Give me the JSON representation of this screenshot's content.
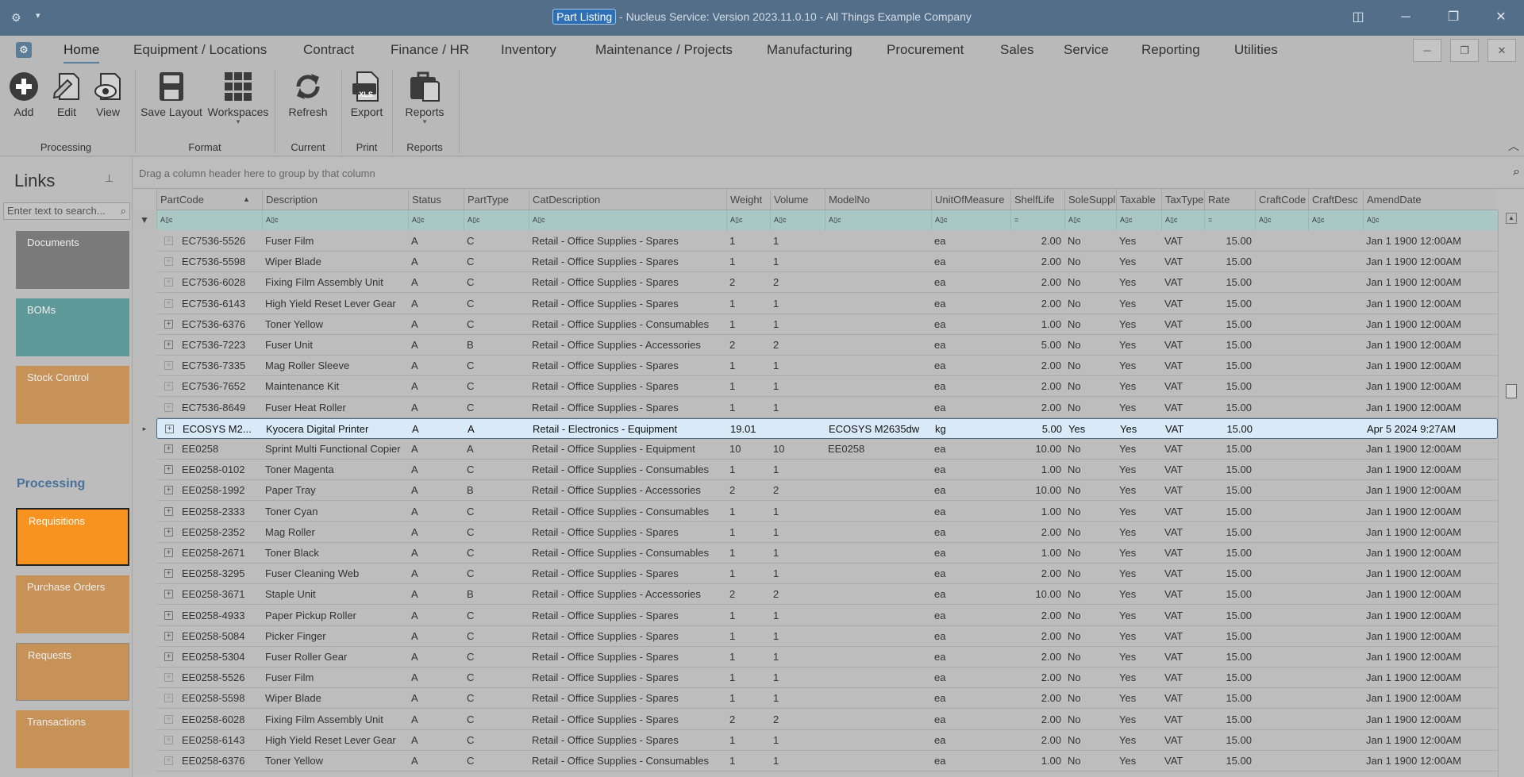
{
  "titlebar": {
    "highlight": "Part Listing",
    "rest": " - Nucleus Service: Version 2023.11.0.10 - All Things Example Company",
    "menu_caret": "▾"
  },
  "menu": {
    "items": [
      "Home",
      "Equipment / Locations",
      "Contract",
      "Finance / HR",
      "Inventory",
      "Maintenance / Projects",
      "Manufacturing",
      "Procurement",
      "Sales",
      "Service",
      "Reporting",
      "Utilities"
    ]
  },
  "ribbon": {
    "buttons": {
      "add": "Add",
      "edit": "Edit",
      "view": "View",
      "save_layout": "Save Layout",
      "workspaces": "Workspaces",
      "refresh": "Refresh",
      "export": "Export",
      "reports": "Reports"
    },
    "groups": {
      "processing": "Processing",
      "format": "Format",
      "current": "Current",
      "print": "Print",
      "reports": "Reports"
    },
    "export_badge": "XLS"
  },
  "links": {
    "title": "Links",
    "search_placeholder": "Enter text to search...",
    "processing_title": "Processing",
    "tiles": [
      "Documents",
      "BOMs",
      "Stock Control",
      "Requisitions",
      "Purchase Orders",
      "Requests",
      "Transactions"
    ]
  },
  "grid": {
    "group_hint": "Drag a column header here to group by that column",
    "filter_abc": "A▯c",
    "filter_eq": "=",
    "columns": [
      "PartCode",
      "Description",
      "Status",
      "PartType",
      "CatDescription",
      "Weight",
      "Volume",
      "ModelNo",
      "UnitOfMeasure",
      "ShelfLife",
      "SoleSupplier",
      "Taxable",
      "TaxType",
      "Rate",
      "CraftCode",
      "CraftDesc",
      "AmendDate"
    ],
    "rows": [
      [
        "EC7536-5526",
        "Fuser Film",
        "A",
        "C",
        "Retail - Office Supplies - Spares",
        "1",
        "1",
        "",
        "ea",
        "2.00",
        "No",
        "Yes",
        "VAT",
        "15.00",
        "",
        "",
        "Jan  1 1900 12:00AM"
      ],
      [
        "EC7536-5598",
        "Wiper Blade",
        "A",
        "C",
        "Retail - Office Supplies - Spares",
        "1",
        "1",
        "",
        "ea",
        "2.00",
        "No",
        "Yes",
        "VAT",
        "15.00",
        "",
        "",
        "Jan  1 1900 12:00AM"
      ],
      [
        "EC7536-6028",
        "Fixing Film Assembly Unit",
        "A",
        "C",
        "Retail - Office Supplies - Spares",
        "2",
        "2",
        "",
        "ea",
        "2.00",
        "No",
        "Yes",
        "VAT",
        "15.00",
        "",
        "",
        "Jan  1 1900 12:00AM"
      ],
      [
        "EC7536-6143",
        "High Yield Reset Lever Gear",
        "A",
        "C",
        "Retail - Office Supplies - Spares",
        "1",
        "1",
        "",
        "ea",
        "2.00",
        "No",
        "Yes",
        "VAT",
        "15.00",
        "",
        "",
        "Jan  1 1900 12:00AM"
      ],
      [
        "EC7536-6376",
        "Toner Yellow",
        "A",
        "C",
        "Retail - Office Supplies - Consumables",
        "1",
        "1",
        "",
        "ea",
        "1.00",
        "No",
        "Yes",
        "VAT",
        "15.00",
        "",
        "",
        "Jan  1 1900 12:00AM"
      ],
      [
        "EC7536-7223",
        "Fuser Unit",
        "A",
        "B",
        "Retail - Office Supplies - Accessories",
        "2",
        "2",
        "",
        "ea",
        "5.00",
        "No",
        "Yes",
        "VAT",
        "15.00",
        "",
        "",
        "Jan  1 1900 12:00AM"
      ],
      [
        "EC7536-7335",
        "Mag Roller Sleeve",
        "A",
        "C",
        "Retail - Office Supplies - Spares",
        "1",
        "1",
        "",
        "ea",
        "2.00",
        "No",
        "Yes",
        "VAT",
        "15.00",
        "",
        "",
        "Jan  1 1900 12:00AM"
      ],
      [
        "EC7536-7652",
        "Maintenance Kit",
        "A",
        "C",
        "Retail - Office Supplies - Spares",
        "1",
        "1",
        "",
        "ea",
        "2.00",
        "No",
        "Yes",
        "VAT",
        "15.00",
        "",
        "",
        "Jan  1 1900 12:00AM"
      ],
      [
        "EC7536-8649",
        "Fuser Heat Roller",
        "A",
        "C",
        "Retail - Office Supplies - Spares",
        "1",
        "1",
        "",
        "ea",
        "2.00",
        "No",
        "Yes",
        "VAT",
        "15.00",
        "",
        "",
        "Jan  1 1900 12:00AM"
      ],
      [
        "ECOSYS M2...",
        "Kyocera Digital Printer",
        "A",
        "A",
        "Retail - Electronics - Equipment",
        "19.01",
        "",
        "ECOSYS M2635dw",
        "kg",
        "5.00",
        "Yes",
        "Yes",
        "VAT",
        "15.00",
        "",
        "",
        "Apr  5 2024  9:27AM"
      ],
      [
        "EE0258",
        "Sprint Multi Functional Copier",
        "A",
        "A",
        "Retail - Office Supplies - Equipment",
        "10",
        "10",
        "EE0258",
        "ea",
        "10.00",
        "No",
        "Yes",
        "VAT",
        "15.00",
        "",
        "",
        "Jan  1 1900 12:00AM"
      ],
      [
        "EE0258-0102",
        "Toner Magenta",
        "A",
        "C",
        "Retail - Office Supplies - Consumables",
        "1",
        "1",
        "",
        "ea",
        "1.00",
        "No",
        "Yes",
        "VAT",
        "15.00",
        "",
        "",
        "Jan  1 1900 12:00AM"
      ],
      [
        "EE0258-1992",
        "Paper Tray",
        "A",
        "B",
        "Retail - Office Supplies - Accessories",
        "2",
        "2",
        "",
        "ea",
        "10.00",
        "No",
        "Yes",
        "VAT",
        "15.00",
        "",
        "",
        "Jan  1 1900 12:00AM"
      ],
      [
        "EE0258-2333",
        "Toner Cyan",
        "A",
        "C",
        "Retail - Office Supplies - Consumables",
        "1",
        "1",
        "",
        "ea",
        "1.00",
        "No",
        "Yes",
        "VAT",
        "15.00",
        "",
        "",
        "Jan  1 1900 12:00AM"
      ],
      [
        "EE0258-2352",
        "Mag Roller",
        "A",
        "C",
        "Retail - Office Supplies - Spares",
        "1",
        "1",
        "",
        "ea",
        "2.00",
        "No",
        "Yes",
        "VAT",
        "15.00",
        "",
        "",
        "Jan  1 1900 12:00AM"
      ],
      [
        "EE0258-2671",
        "Toner Black",
        "A",
        "C",
        "Retail - Office Supplies - Consumables",
        "1",
        "1",
        "",
        "ea",
        "1.00",
        "No",
        "Yes",
        "VAT",
        "15.00",
        "",
        "",
        "Jan  1 1900 12:00AM"
      ],
      [
        "EE0258-3295",
        "Fuser Cleaning Web",
        "A",
        "C",
        "Retail - Office Supplies - Spares",
        "1",
        "1",
        "",
        "ea",
        "2.00",
        "No",
        "Yes",
        "VAT",
        "15.00",
        "",
        "",
        "Jan  1 1900 12:00AM"
      ],
      [
        "EE0258-3671",
        "Staple Unit",
        "A",
        "B",
        "Retail - Office Supplies - Accessories",
        "2",
        "2",
        "",
        "ea",
        "10.00",
        "No",
        "Yes",
        "VAT",
        "15.00",
        "",
        "",
        "Jan  1 1900 12:00AM"
      ],
      [
        "EE0258-4933",
        "Paper Pickup Roller",
        "A",
        "C",
        "Retail - Office Supplies - Spares",
        "1",
        "1",
        "",
        "ea",
        "2.00",
        "No",
        "Yes",
        "VAT",
        "15.00",
        "",
        "",
        "Jan  1 1900 12:00AM"
      ],
      [
        "EE0258-5084",
        "Picker Finger",
        "A",
        "C",
        "Retail - Office Supplies - Spares",
        "1",
        "1",
        "",
        "ea",
        "2.00",
        "No",
        "Yes",
        "VAT",
        "15.00",
        "",
        "",
        "Jan  1 1900 12:00AM"
      ],
      [
        "EE0258-5304",
        "Fuser Roller Gear",
        "A",
        "C",
        "Retail - Office Supplies - Spares",
        "1",
        "1",
        "",
        "ea",
        "2.00",
        "No",
        "Yes",
        "VAT",
        "15.00",
        "",
        "",
        "Jan  1 1900 12:00AM"
      ],
      [
        "EE0258-5526",
        "Fuser Film",
        "A",
        "C",
        "Retail - Office Supplies - Spares",
        "1",
        "1",
        "",
        "ea",
        "2.00",
        "No",
        "Yes",
        "VAT",
        "15.00",
        "",
        "",
        "Jan  1 1900 12:00AM"
      ],
      [
        "EE0258-5598",
        "Wiper Blade",
        "A",
        "C",
        "Retail - Office Supplies - Spares",
        "1",
        "1",
        "",
        "ea",
        "2.00",
        "No",
        "Yes",
        "VAT",
        "15.00",
        "",
        "",
        "Jan  1 1900 12:00AM"
      ],
      [
        "EE0258-6028",
        "Fixing Film Assembly Unit",
        "A",
        "C",
        "Retail - Office Supplies - Spares",
        "2",
        "2",
        "",
        "ea",
        "2.00",
        "No",
        "Yes",
        "VAT",
        "15.00",
        "",
        "",
        "Jan  1 1900 12:00AM"
      ],
      [
        "EE0258-6143",
        "High Yield Reset Lever Gear",
        "A",
        "C",
        "Retail - Office Supplies - Spares",
        "1",
        "1",
        "",
        "ea",
        "2.00",
        "No",
        "Yes",
        "VAT",
        "15.00",
        "",
        "",
        "Jan  1 1900 12:00AM"
      ],
      [
        "EE0258-6376",
        "Toner Yellow",
        "A",
        "C",
        "Retail - Office Supplies - Consumables",
        "1",
        "1",
        "",
        "ea",
        "1.00",
        "No",
        "Yes",
        "VAT",
        "15.00",
        "",
        "",
        "Jan  1 1900 12:00AM"
      ]
    ],
    "selected_row": 9
  },
  "colors": {
    "titlebar": "#536e88",
    "tile_documents": "#7a7a7a",
    "tile_boms": "#5f9898",
    "tile_orange": "#c79258",
    "tile_active": "#f7931e",
    "filter_row": "#a8c7c5",
    "selected_row": "#d9e9f7"
  }
}
